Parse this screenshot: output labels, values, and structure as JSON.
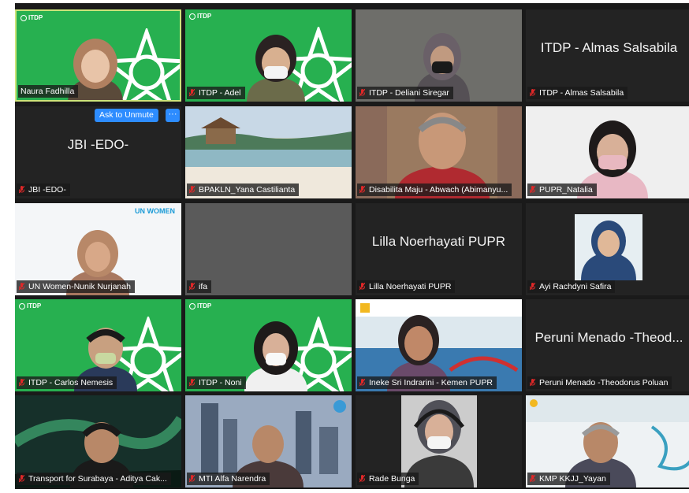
{
  "colors": {
    "itdp_green": "#27b050",
    "active_speaker_border": "#cde47a",
    "unmute_blue": "#2d8cff",
    "muted_red": "#e02828"
  },
  "itdp_logo_text": "ITDP",
  "unmute_prompt": {
    "label": "Ask to Unmute",
    "more": "···"
  },
  "unwomen_logo": "UN WOMEN",
  "participants": [
    {
      "name": "Naura Fadhilla",
      "muted": false,
      "speaking": true
    },
    {
      "name": "ITDP - Adel",
      "muted": true
    },
    {
      "name": "ITDP - Deliani Siregar",
      "muted": true
    },
    {
      "name": "ITDP - Almas Salsabila",
      "muted": true,
      "display_name": "ITDP - Almas Salsabila"
    },
    {
      "name": "JBI -EDO-",
      "muted": true,
      "display_name": "JBI -EDO-"
    },
    {
      "name": "BPAKLN_Yana Castilianta",
      "muted": true
    },
    {
      "name": "Disabilita Maju - Abwach (Abimanyu...",
      "muted": true
    },
    {
      "name": "PUPR_Natalia",
      "muted": true
    },
    {
      "name": "UN Women-Nunik Nurjanah",
      "muted": true
    },
    {
      "name": "ifa",
      "muted": true
    },
    {
      "name": "Lilla Noerhayati PUPR",
      "muted": true,
      "display_name": "Lilla Noerhayati PUPR"
    },
    {
      "name": "Ayi Rachdyni Safira",
      "muted": true
    },
    {
      "name": "ITDP - Carlos Nemesis",
      "muted": true
    },
    {
      "name": "ITDP - Noni",
      "muted": true
    },
    {
      "name": "Ineke Sri Indrarini - Kemen PUPR",
      "muted": true
    },
    {
      "name": "Peruni Menado -Theodorus Poluan",
      "muted": true,
      "display_name": "Peruni Menado -Theod..."
    },
    {
      "name": "Transport for Surabaya - Aditya Cak...",
      "muted": true
    },
    {
      "name": "MTI Alfa Narendra",
      "muted": true
    },
    {
      "name": "Rade Bunga",
      "muted": true
    },
    {
      "name": "KMP KKJJ_Yayan",
      "muted": true
    }
  ]
}
